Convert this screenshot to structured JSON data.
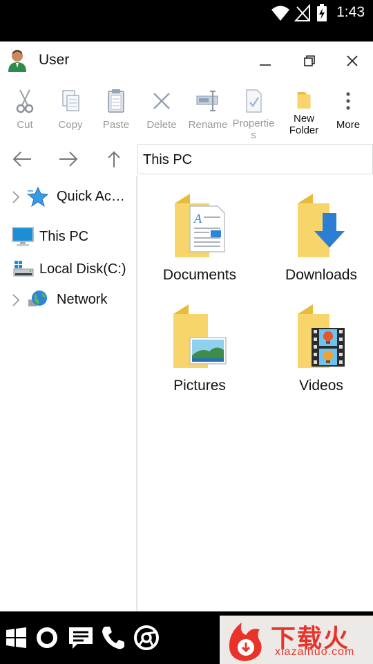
{
  "status_bar": {
    "time": "1:43"
  },
  "window": {
    "title": "User",
    "minimize_icon": "minimize-icon",
    "restore_icon": "restore-icon",
    "close_icon": "close-icon"
  },
  "ribbon": [
    {
      "label": "Cut",
      "icon": "scissors-icon",
      "enabled": false
    },
    {
      "label": "Copy",
      "icon": "copy-icon",
      "enabled": false
    },
    {
      "label": "Paste",
      "icon": "paste-icon",
      "enabled": false
    },
    {
      "label": "Delete",
      "icon": "delete-icon",
      "enabled": false
    },
    {
      "label": "Rename",
      "icon": "rename-icon",
      "enabled": false
    },
    {
      "label": "Properties",
      "icon": "properties-icon",
      "enabled": false
    },
    {
      "label": "New Folder",
      "icon": "new-folder-icon",
      "enabled": true
    },
    {
      "label": "More",
      "icon": "more-icon",
      "enabled": true
    }
  ],
  "address_bar": {
    "path": "This PC"
  },
  "sidebar": {
    "items": [
      {
        "label": "Quick Ac…",
        "icon": "star-icon",
        "expandable": true
      },
      {
        "label": "This PC",
        "icon": "monitor-icon",
        "expandable": false
      },
      {
        "label": "Local Disk(C:)",
        "icon": "drive-icon",
        "expandable": false
      },
      {
        "label": "Network",
        "icon": "globe-icon",
        "expandable": true
      }
    ]
  },
  "folders": [
    {
      "label": "Documents",
      "icon": "documents-folder-icon"
    },
    {
      "label": "Downloads",
      "icon": "downloads-folder-icon"
    },
    {
      "label": "Pictures",
      "icon": "pictures-folder-icon"
    },
    {
      "label": "Videos",
      "icon": "videos-folder-icon"
    }
  ],
  "taskbar": {
    "icons": [
      "windows-icon",
      "search-circle-icon",
      "message-icon",
      "phone-icon",
      "chrome-icon"
    ],
    "watermark": {
      "main": "下载火",
      "sub": "xiazaihuo.com"
    }
  },
  "colors": {
    "folder": "#f7d56a",
    "folder_back": "#e9bb3c",
    "accent": "#2a7fd4",
    "disabled_text": "#9a9a9a"
  }
}
